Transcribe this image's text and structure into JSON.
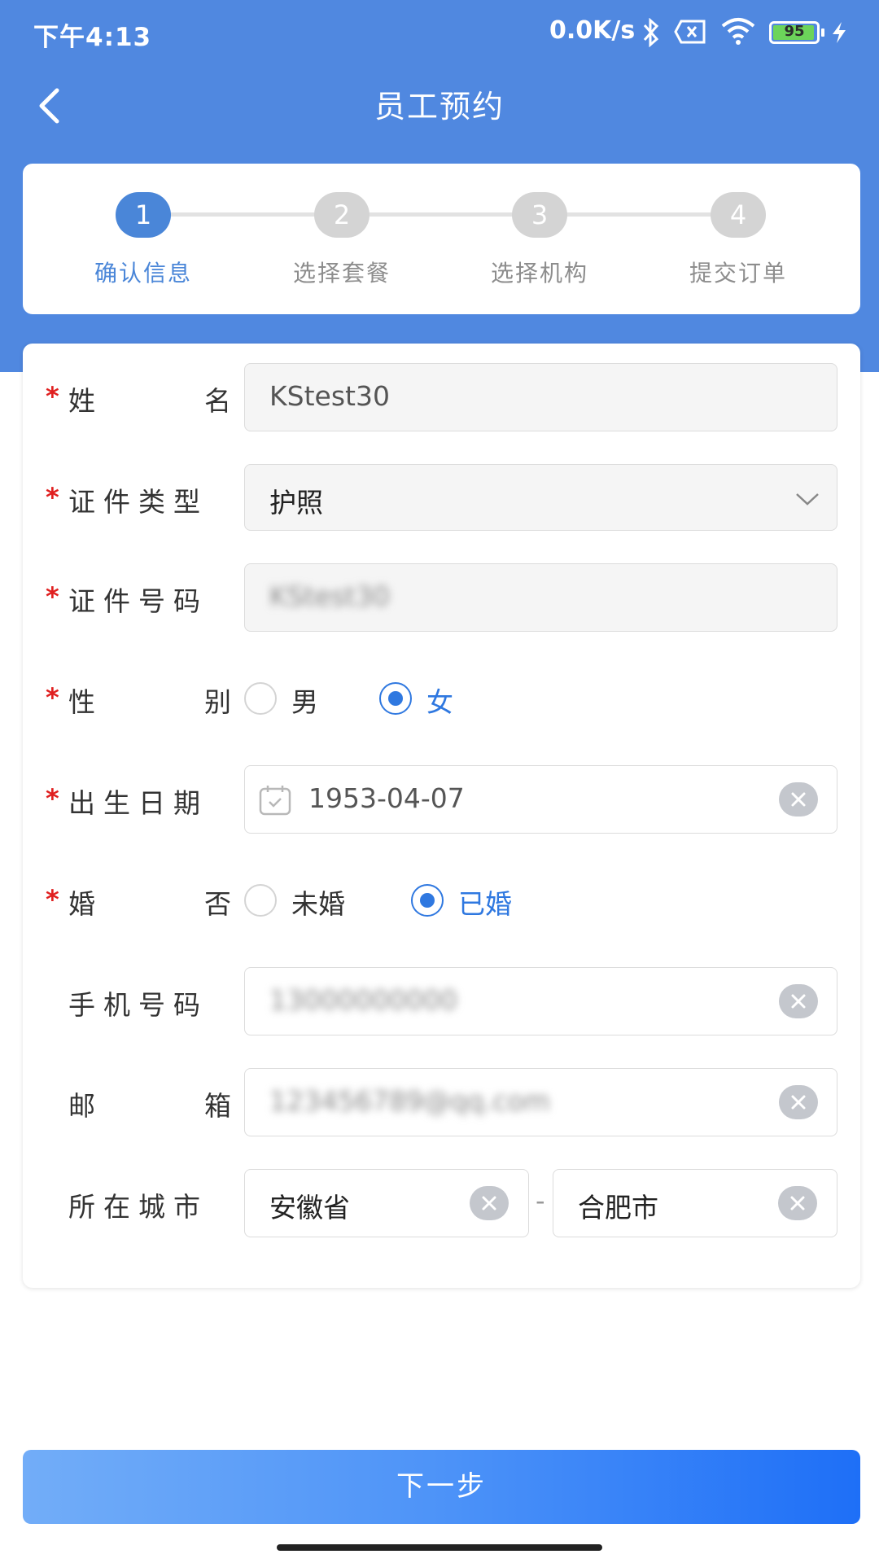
{
  "status_bar": {
    "time": "下午4:13",
    "net_speed": "0.0K/s",
    "battery": "95",
    "icons": [
      "bluetooth-icon",
      "sim-off-icon",
      "wifi-icon",
      "battery-icon",
      "charging-icon"
    ]
  },
  "nav": {
    "title": "员工预约",
    "back_icon": "chevron-left-icon"
  },
  "steps": [
    {
      "number": "1",
      "label": "确认信息",
      "active": true
    },
    {
      "number": "2",
      "label": "选择套餐",
      "active": false
    },
    {
      "number": "3",
      "label": "选择机构",
      "active": false
    },
    {
      "number": "4",
      "label": "提交订单",
      "active": false
    }
  ],
  "form": {
    "required_mark": "*",
    "name": {
      "label_parts": [
        "姓",
        "名"
      ],
      "value": "KStest30"
    },
    "id_type": {
      "label": "证件类型",
      "value": "护照"
    },
    "id_number": {
      "label": "证件号码",
      "value": "KStest30"
    },
    "gender": {
      "label_parts": [
        "性",
        "别"
      ],
      "options": [
        "男",
        "女"
      ],
      "selected": "女"
    },
    "birth_date": {
      "label": "出生日期",
      "value": "1953-04-07",
      "icon": "calendar-icon"
    },
    "marital": {
      "label_parts": [
        "婚",
        "否"
      ],
      "options": [
        "未婚",
        "已婚"
      ],
      "selected": "已婚"
    },
    "phone": {
      "label": "手机号码",
      "value": "13000000000"
    },
    "email": {
      "label_parts": [
        "邮",
        "箱"
      ],
      "value": "123456789@qq.com"
    },
    "city": {
      "label": "所在城市",
      "province": "安徽省",
      "separator": "-",
      "city": "合肥市"
    }
  },
  "next_button": {
    "label": "下一步"
  },
  "colors": {
    "header": "#5088e0",
    "accent": "#2f78e0",
    "required": "#e02020"
  }
}
